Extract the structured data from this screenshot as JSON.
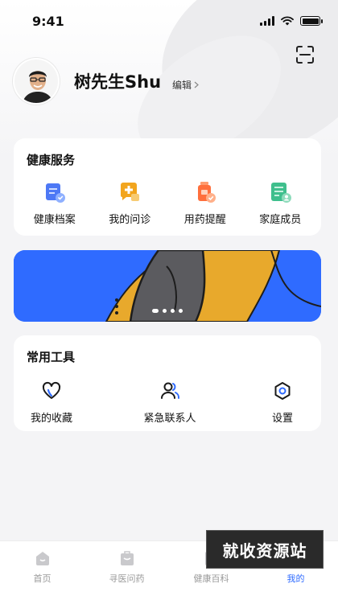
{
  "status_bar": {
    "time": "9:41"
  },
  "profile": {
    "name": "树先生Shu",
    "edit_label": "编辑"
  },
  "services": {
    "title": "健康服务",
    "items": [
      {
        "label": "健康档案",
        "icon": "health-record-icon"
      },
      {
        "label": "我的问诊",
        "icon": "consultation-icon"
      },
      {
        "label": "用药提醒",
        "icon": "medication-reminder-icon"
      },
      {
        "label": "家庭成员",
        "icon": "family-members-icon"
      }
    ]
  },
  "banner": {
    "page_count": 4,
    "active_index": 0
  },
  "tools": {
    "title": "常用工具",
    "items": [
      {
        "label": "我的收藏",
        "icon": "heart-icon"
      },
      {
        "label": "紧急联系人",
        "icon": "contacts-icon"
      },
      {
        "label": "设置",
        "icon": "settings-icon"
      }
    ]
  },
  "tab_bar": {
    "items": [
      {
        "label": "首页",
        "icon": "home-icon",
        "active": false
      },
      {
        "label": "寻医问药",
        "icon": "medicine-bag-icon",
        "active": false
      },
      {
        "label": "健康百科",
        "icon": "encyclopedia-icon",
        "active": false
      },
      {
        "label": "我的",
        "icon": "profile-icon",
        "active": true
      }
    ]
  },
  "watermark": {
    "text": "就收资源站"
  },
  "colors": {
    "accent": "#2f6bff",
    "banner_yellow": "#e8a92c"
  }
}
